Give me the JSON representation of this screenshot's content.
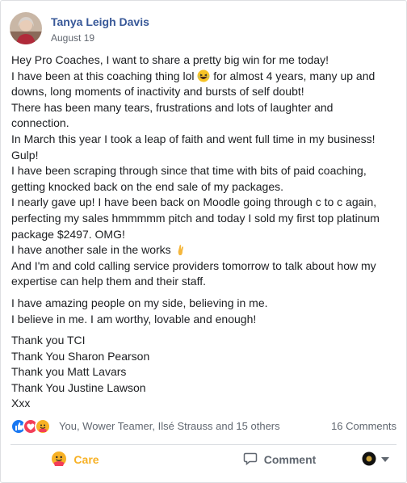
{
  "post": {
    "author": "Tanya Leigh Davis",
    "date": "August 19",
    "body": [
      [
        "Hey Pro Coaches, I want to share a pretty big win for me today!",
        [
          "I have been at this coaching thing lol ",
          "laughing-face-icon",
          " for almost 4 years, many up and"
        ],
        "downs, long moments of inactivity and bursts of self doubt!",
        "There has been many tears, frustrations and lots of laughter and",
        "connection.",
        "In March this year I took a leap of faith and went full time in my business!",
        "Gulp!",
        "I have been scraping through since that time with bits of paid coaching,",
        "getting knocked back on the end sale of my packages.",
        "I nearly gave up! I have been back on Moodle going through c to c again,",
        "perfecting my sales hmmmmm pitch and today I sold my first top platinum",
        "package $2497. OMG!",
        [
          "I have another sale in the works ",
          "crossed-fingers-icon",
          ""
        ],
        "And I'm and cold calling service providers tomorrow to talk about how my",
        "expertise can help them and their staff."
      ],
      [
        "I have amazing people on my side, believing in me.",
        "I believe in me. I am worthy, lovable and enough!"
      ],
      [
        "Thank you TCI",
        "Thank You Sharon Pearson",
        "Thank you Matt Lavars",
        "Thank You Justine Lawson",
        "Xxx"
      ]
    ]
  },
  "reactions": {
    "icons": [
      "like-reaction-icon",
      "love-reaction-icon",
      "care-reaction-icon"
    ],
    "summary": "You, Wower Teamer, Ilsé Strauss and 15 others",
    "comments": "16 Comments"
  },
  "actions": {
    "care_label": "Care",
    "comment_label": "Comment"
  },
  "colors": {
    "author": "#385898",
    "care": "#f7b125",
    "like": "#1877f2",
    "love": "#f33e58"
  }
}
